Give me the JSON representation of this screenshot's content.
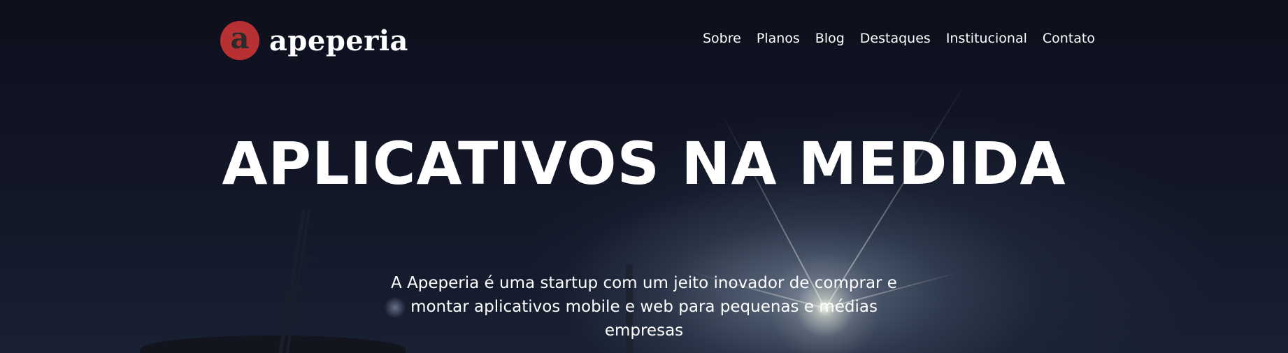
{
  "brand": {
    "logo_letter": "a",
    "name": "apeperia",
    "accent_color": "#b83132"
  },
  "nav": {
    "items": [
      {
        "label": "Sobre"
      },
      {
        "label": "Planos"
      },
      {
        "label": "Blog"
      },
      {
        "label": "Destaques"
      },
      {
        "label": "Institucional"
      },
      {
        "label": "Contato"
      }
    ]
  },
  "hero": {
    "headline": "APLICATIVOS NA MEDIDA",
    "subtitle": "A Apeperia é uma startup com um jeito inovador de comprar e montar aplicativos mobile e web para pequenas e médias empresas"
  }
}
